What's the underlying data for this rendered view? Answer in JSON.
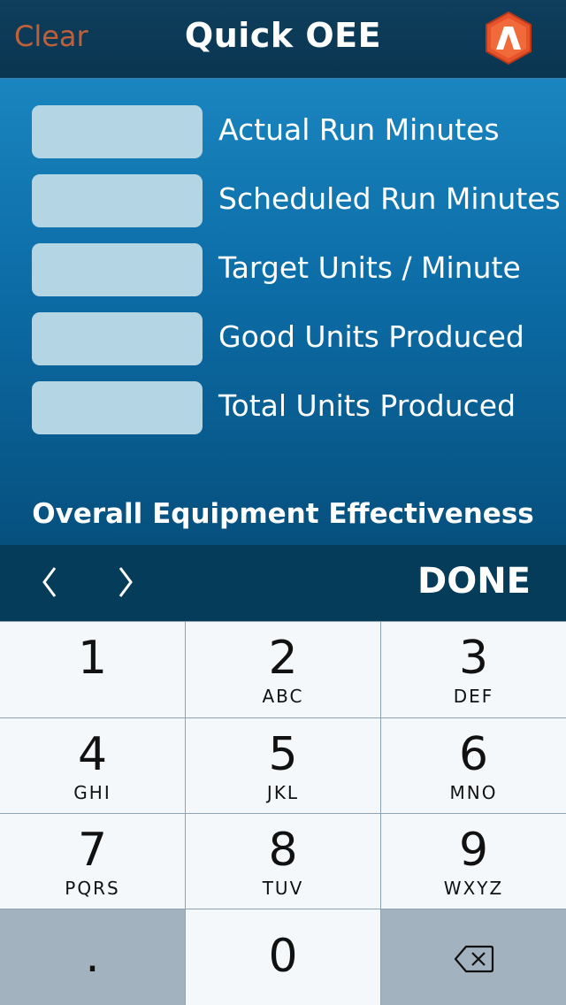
{
  "navbar": {
    "clear_label": "Clear",
    "title": "Quick OEE",
    "logo_icon": "app-logo-hexagon-icon",
    "logo_color": "#e8522a"
  },
  "form": {
    "fields": [
      {
        "label": "Actual Run Minutes",
        "value": ""
      },
      {
        "label": "Scheduled Run Minutes",
        "value": ""
      },
      {
        "label": "Target Units / Minute",
        "value": ""
      },
      {
        "label": "Good Units Produced",
        "value": ""
      },
      {
        "label": "Total Units Produced",
        "value": ""
      }
    ],
    "result_title": "Overall Equipment Effectiveness"
  },
  "accessory": {
    "prev_icon": "chevron-left-icon",
    "next_icon": "chevron-right-icon",
    "done_label": "DONE"
  },
  "keypad": {
    "keys": [
      {
        "digit": "1",
        "letters": ""
      },
      {
        "digit": "2",
        "letters": "ABC"
      },
      {
        "digit": "3",
        "letters": "DEF"
      },
      {
        "digit": "4",
        "letters": "GHI"
      },
      {
        "digit": "5",
        "letters": "JKL"
      },
      {
        "digit": "6",
        "letters": "MNO"
      },
      {
        "digit": "7",
        "letters": "PQRS"
      },
      {
        "digit": "8",
        "letters": "TUV"
      },
      {
        "digit": "9",
        "letters": "WXYZ"
      }
    ],
    "decimal": ".",
    "zero": "0",
    "delete_icon": "backspace-icon"
  },
  "colors": {
    "accent_orange": "#c0603a",
    "navbar_bg": "#0e3f5d",
    "field_bg": "#b4d6e4",
    "accessory_bg": "#053c5a"
  }
}
